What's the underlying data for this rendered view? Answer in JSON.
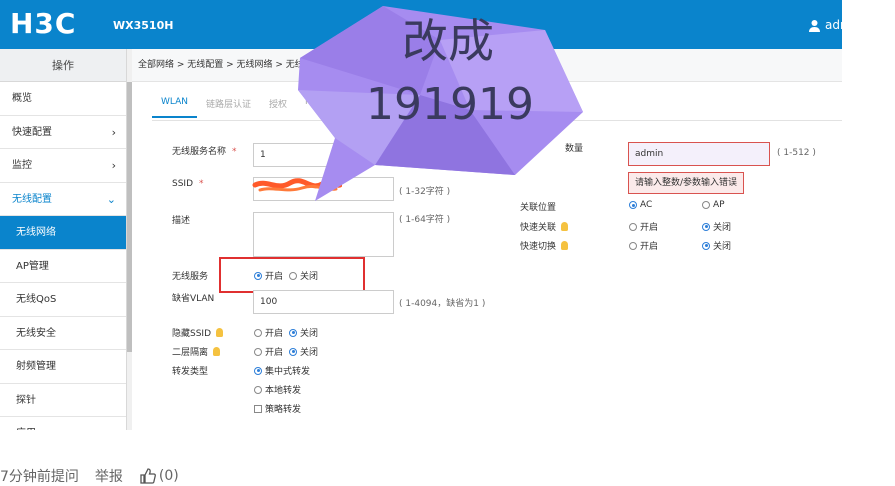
{
  "header": {
    "logo": "H3C",
    "model": "WX3510H",
    "user": "adr"
  },
  "sidebar": {
    "title": "操作",
    "items": [
      {
        "label": "概览"
      },
      {
        "label": "快速配置"
      },
      {
        "label": "监控"
      },
      {
        "label": "无线配置"
      },
      {
        "label": "无线网络"
      },
      {
        "label": "AP管理"
      },
      {
        "label": "无线QoS"
      },
      {
        "label": "无线安全"
      },
      {
        "label": "射频管理"
      },
      {
        "label": "探针"
      },
      {
        "label": "应用"
      }
    ]
  },
  "breadcrumb": "全部网络 > 无线配置 > 无线网络 > 无线网络",
  "tabs": [
    "WLAN",
    "链路层认证",
    "授权",
    "R"
  ],
  "form": {
    "service_name_label": "无线服务名称",
    "service_name_value": "1",
    "ssid_label": "SSID",
    "ssid_hint": "( 1-32字符 )",
    "desc_label": "描述",
    "desc_hint": "( 1-64字符 )",
    "service_label": "无线服务",
    "on": "开启",
    "off": "关闭",
    "vlan_label": "缺省VLAN",
    "vlan_value": "100",
    "vlan_hint": "( 1-4094，缺省为1 )",
    "hide_ssid_label": "隐藏SSID",
    "l2_isolation_label": "二层隔离",
    "forward_label": "转发类型",
    "fwd_central": "集中式转发",
    "fwd_local": "本地转发",
    "fwd_policy": "策略转发",
    "right_count_label": "数量",
    "right_count_value": "admin",
    "right_count_hint": "( 1-512 )",
    "error_msg": "请输入整数/参数输入错误",
    "assoc_label": "关联位置",
    "assoc_ac": "AC",
    "assoc_ap": "AP",
    "fast_assoc_label": "快速关联",
    "fast_switch_label": "快速切换"
  },
  "overlay": {
    "line1": "改成",
    "line2": "191919"
  },
  "footer": {
    "time": "7分钟前提问",
    "report": "举报",
    "likes": "(0)"
  },
  "colors": {
    "brand": "#0a84cc",
    "overlay": "#a68cf0",
    "highlight": "#e03030"
  }
}
